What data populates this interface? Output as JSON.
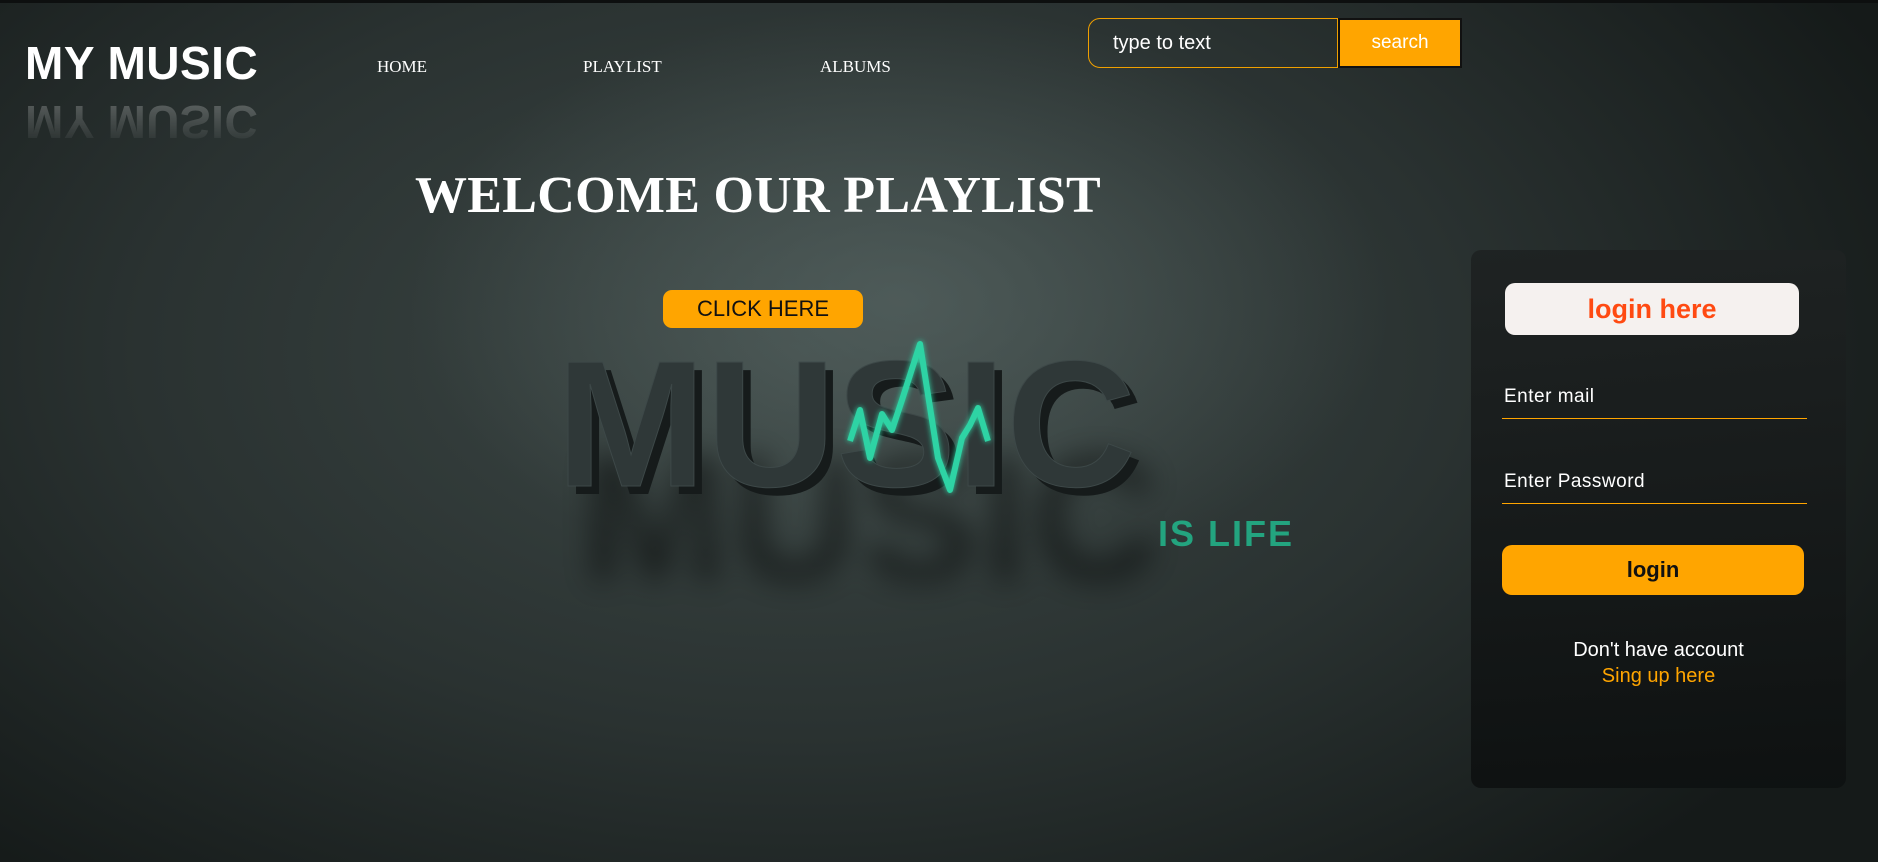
{
  "brand": {
    "logo": "MY MUSIC"
  },
  "nav": {
    "items": [
      {
        "label": "HOME"
      },
      {
        "label": "PLAYLIST"
      },
      {
        "label": "ALBUMS"
      }
    ]
  },
  "search": {
    "placeholder": "type to text",
    "button_label": "search"
  },
  "hero": {
    "title": "WELCOME OUR PLAYLIST",
    "cta_label": "CLICK HERE",
    "graphic_word": "MUSIC",
    "graphic_tagline": "IS LIFE"
  },
  "login": {
    "title": "login here",
    "email_placeholder": "Enter mail",
    "password_placeholder": "Enter Password",
    "button_label": "login",
    "no_account_text": "Don't have account",
    "signup_link": "Sing up here"
  },
  "colors": {
    "accent": "#ffa500",
    "login_title": "#ff4a12",
    "pulse": "#2fd3a4",
    "background": "#2b3433"
  }
}
